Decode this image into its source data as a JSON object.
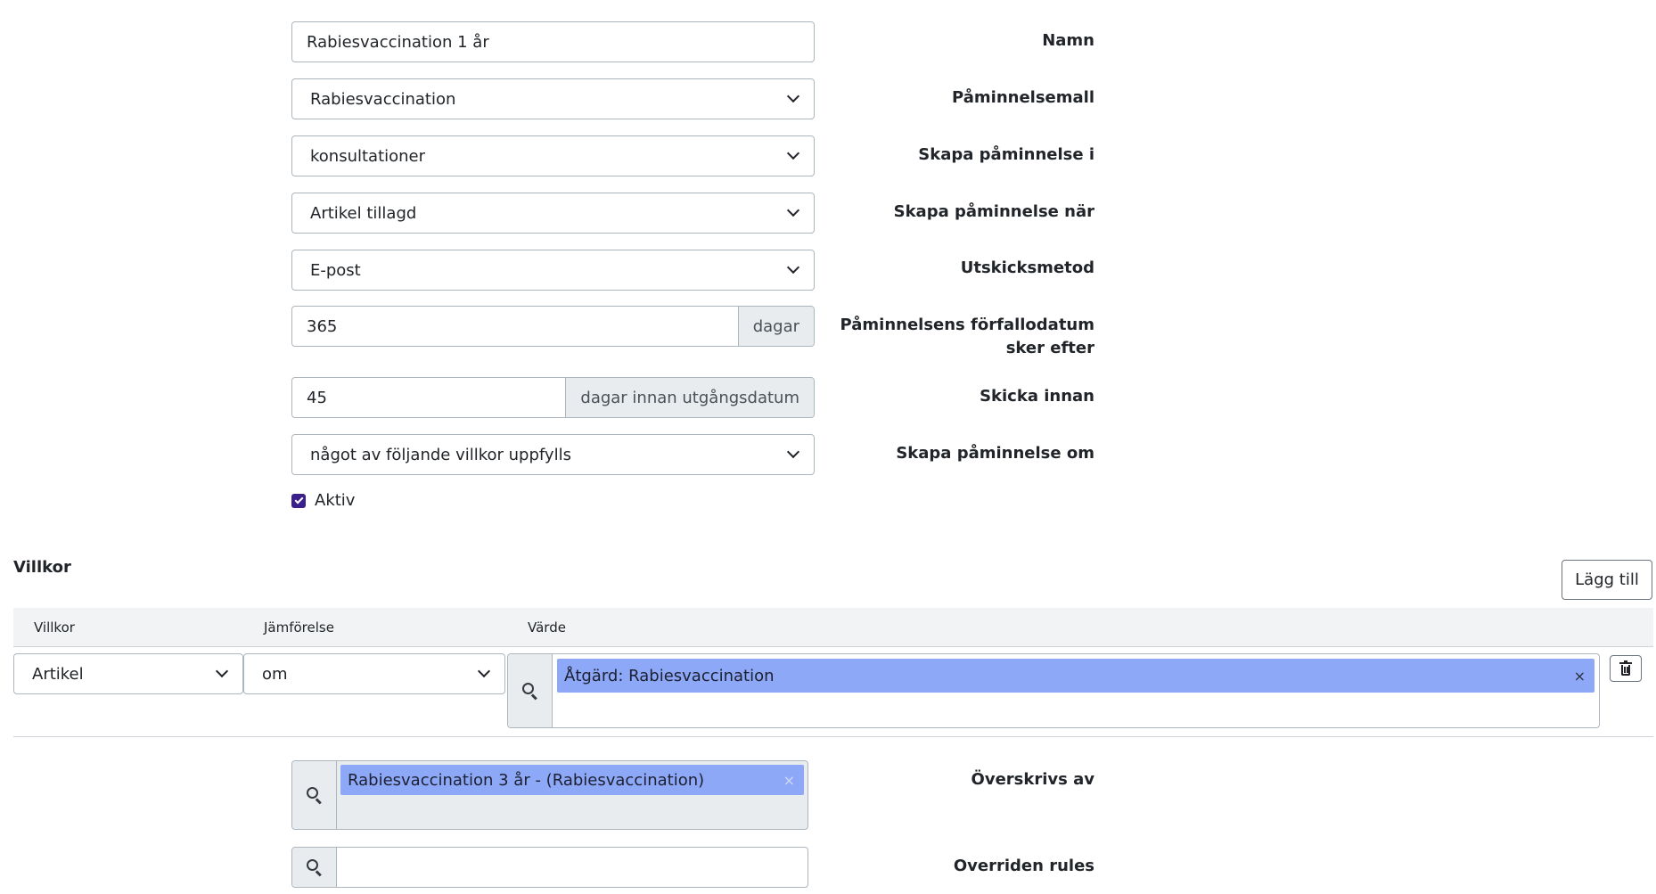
{
  "form": {
    "name": {
      "label": "Namn",
      "value": "Rabiesvaccination 1 år"
    },
    "template": {
      "label": "Påminnelsemall",
      "value": "Rabiesvaccination"
    },
    "create_in": {
      "label": "Skapa påminnelse i",
      "value": "konsultationer"
    },
    "create_when": {
      "label": "Skapa påminnelse när",
      "value": "Artikel tillagd"
    },
    "send_method": {
      "label": "Utskicksmetod",
      "value": "E-post"
    },
    "due_after": {
      "label_line1": "Påminnelsens förfallodatum",
      "label_line2": "sker efter",
      "value": "365",
      "unit": "dagar"
    },
    "send_before": {
      "label": "Skicka innan",
      "value": "45",
      "unit": "dagar innan utgångsdatum"
    },
    "create_if": {
      "label": "Skapa påminnelse om",
      "value": "något av följande villkor uppfylls"
    },
    "active": {
      "label": "Aktiv",
      "checked": true
    }
  },
  "conditions": {
    "title": "Villkor",
    "add_label": "Lägg till",
    "headers": [
      "Villkor",
      "Jämförelse",
      "Värde"
    ],
    "rows": [
      {
        "condition": "Artikel",
        "comparison": "om",
        "value_tag": "Åtgärd: Rabiesvaccination",
        "remove": "×"
      }
    ]
  },
  "overridden_by": {
    "label": "Överskrivs av",
    "tag": "Rabiesvaccination 3 år - (Rabiesvaccination)",
    "remove": "×"
  },
  "overridden_rules": {
    "label": "Overriden rules",
    "value": ""
  },
  "colors": {
    "checkbox": "#3b1f8a",
    "tag": "#8ea8f8",
    "addon": "#e9ecef"
  }
}
